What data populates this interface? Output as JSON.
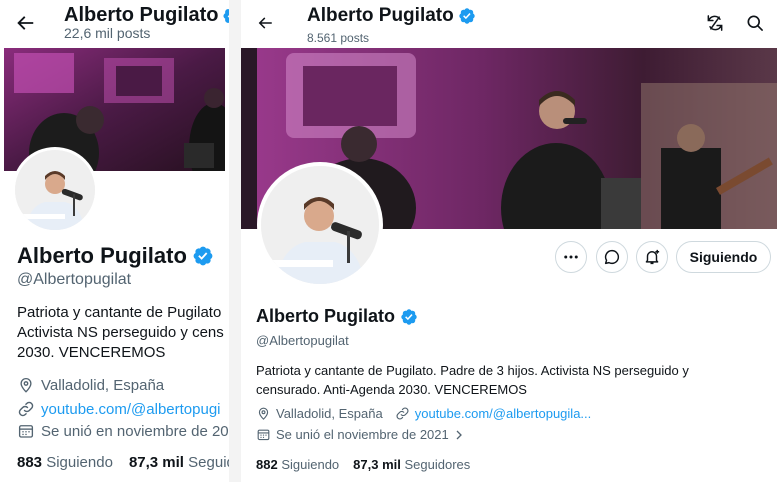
{
  "left": {
    "header": {
      "title": "Alberto Pugilato",
      "posts": "22,6 mil posts"
    },
    "profile": {
      "name": "Alberto Pugilato",
      "handle": "@Albertopugilat",
      "bio": "Patriota y cantante de Pugilato\nActivista NS perseguido y cens\n2030. VENCEREMOS",
      "location": "Valladolid, España",
      "website": "youtube.com/@albertopugi",
      "joined": "Se unió en noviembre de 20"
    },
    "stats": {
      "following_count": "883",
      "following_label": "Siguiendo",
      "followers_count": "87,3 mil",
      "followers_label": "Seguid"
    }
  },
  "right": {
    "header": {
      "title": "Alberto Pugilato",
      "posts": "8.561 posts"
    },
    "actions": {
      "follow_label": "Siguiendo"
    },
    "profile": {
      "name": "Alberto Pugilato",
      "handle": "@Albertopugilat",
      "bio": "Patriota y cantante de Pugilato. Padre de 3 hijos. Activista NS perseguido y\ncensurado. Anti-Agenda 2030. VENCEREMOS",
      "location": "Valladolid, España",
      "website": "youtube.com/@albertopugila...",
      "joined": "Se unió el noviembre de 2021"
    },
    "stats": {
      "following_count": "882",
      "following_label": "Siguiendo",
      "followers_count": "87,3 mil",
      "followers_label": "Seguidores"
    }
  },
  "colors": {
    "verified": "#1d9bf0",
    "link": "#1d9bf0",
    "muted": "#536471"
  },
  "icons": [
    "back-arrow-icon",
    "verified-badge-icon",
    "location-icon",
    "link-icon",
    "calendar-icon",
    "chevron-right-icon",
    "more-icon",
    "message-icon",
    "notification-icon",
    "translate-icon",
    "search-icon"
  ]
}
